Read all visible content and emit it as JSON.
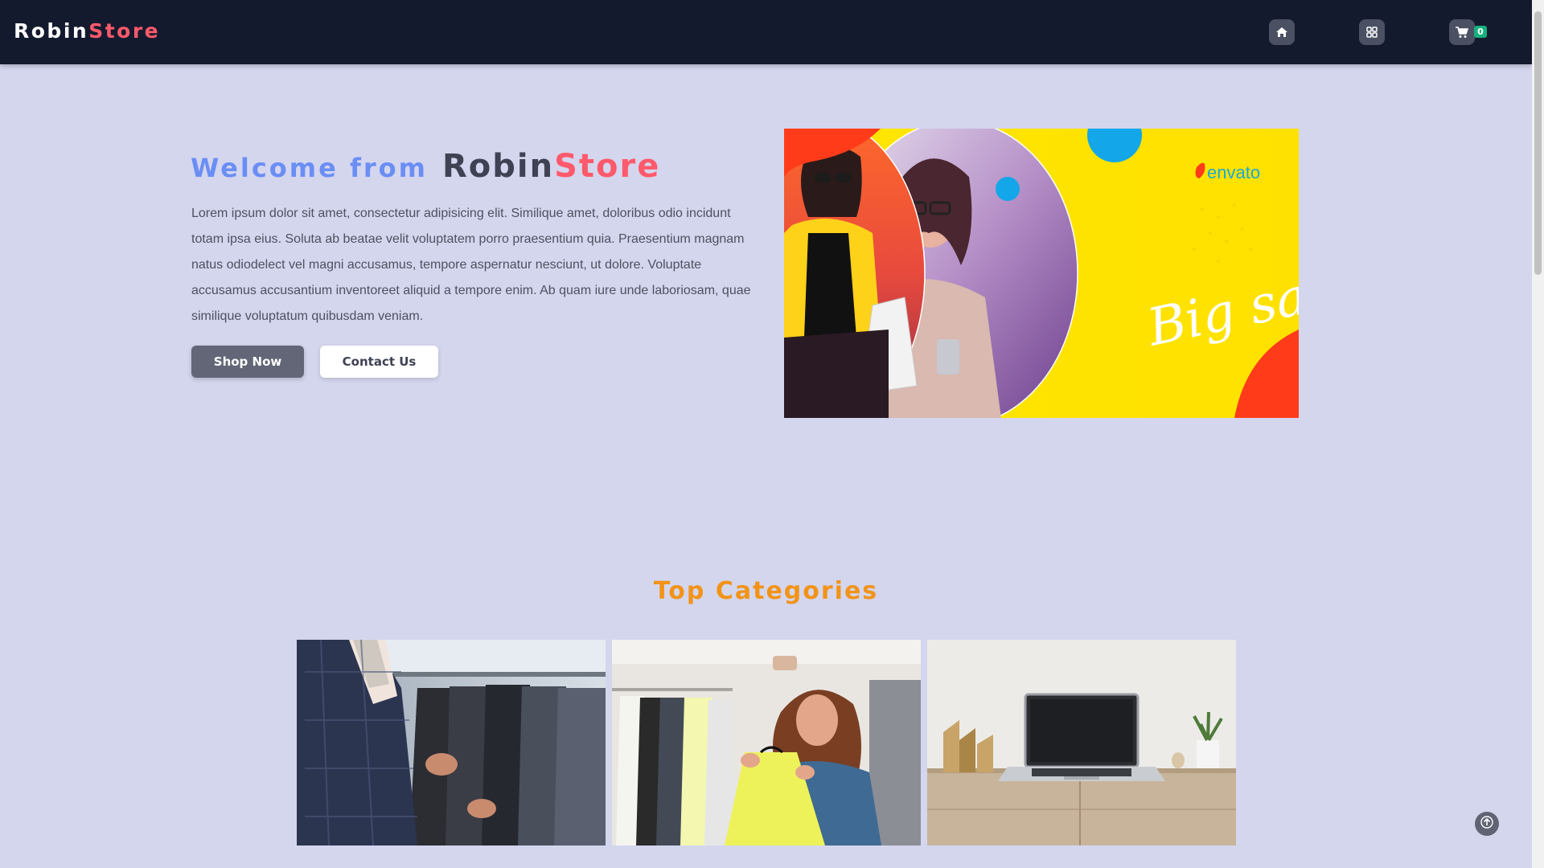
{
  "brand": {
    "part1": "Robin",
    "part2": "Store"
  },
  "nav": {
    "items": [
      {
        "name": "home",
        "icon": "home-icon"
      },
      {
        "name": "categories",
        "icon": "grid-icon"
      },
      {
        "name": "cart",
        "icon": "cart-icon"
      }
    ],
    "cart_count": "0"
  },
  "hero": {
    "welcome": "Welcome from",
    "brand_part1": "Robin",
    "brand_part2": "Store",
    "body": "Lorem ipsum dolor sit amet, consectetur adipisicing elit. Similique amet, doloribus odio incidunt totam ipsa eius. Soluta ab beatae velit voluptatem porro praesentium quia. Praesentium magnam natus odiodelect vel magni accusamus, tempore aspernatur nesciunt, ut dolore. Voluptate accusamus accusantium inventoreet aliquid a tempore enim. Ab quam iure unde laboriosam, quae similique voluptatum quibusdam veniam.",
    "shop_label": "Shop Now",
    "contact_label": "Contact Us",
    "banner": {
      "logo_text": "envato",
      "script_text": "Big sal"
    }
  },
  "categories": {
    "title": "Top Categories",
    "items": [
      {
        "name": "men-clothing"
      },
      {
        "name": "women-clothing"
      },
      {
        "name": "electronics"
      }
    ]
  },
  "colors": {
    "nav_bg": "#141a2e",
    "page_bg": "#d4d6ee",
    "brand_accent": "#ff5a6b",
    "welcome_blue": "#6b8ef5",
    "category_title": "#f29318",
    "badge_green": "#15b07c"
  }
}
